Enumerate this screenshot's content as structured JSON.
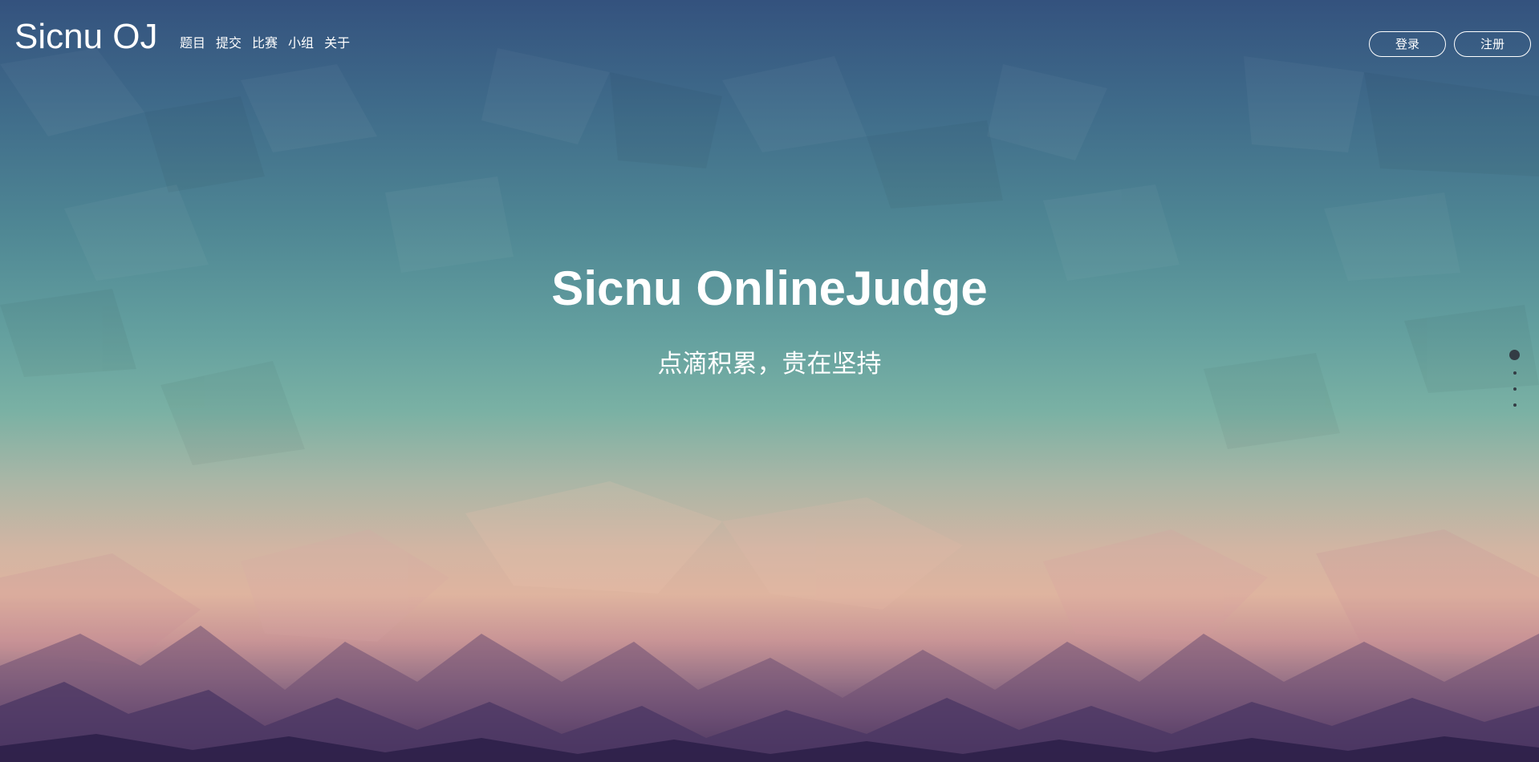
{
  "navbar": {
    "brand": "Sicnu OJ",
    "links": [
      {
        "label": "题目"
      },
      {
        "label": "提交"
      },
      {
        "label": "比赛"
      },
      {
        "label": "小组"
      },
      {
        "label": "关于"
      }
    ],
    "login_label": "登录",
    "register_label": "注册"
  },
  "hero": {
    "title": "Sicnu OnlineJudge",
    "subtitle": "点滴积累，贵在坚持"
  },
  "section_nav": {
    "count": 4,
    "active_index": 0
  },
  "colors": {
    "sky_top": "#34527e",
    "teal": "#64a09f",
    "peach": "#dfb49f",
    "mauve": "#9b7588",
    "purple_bottom": "#2a1f45",
    "text": "#ffffff",
    "dot": "#333c44"
  }
}
